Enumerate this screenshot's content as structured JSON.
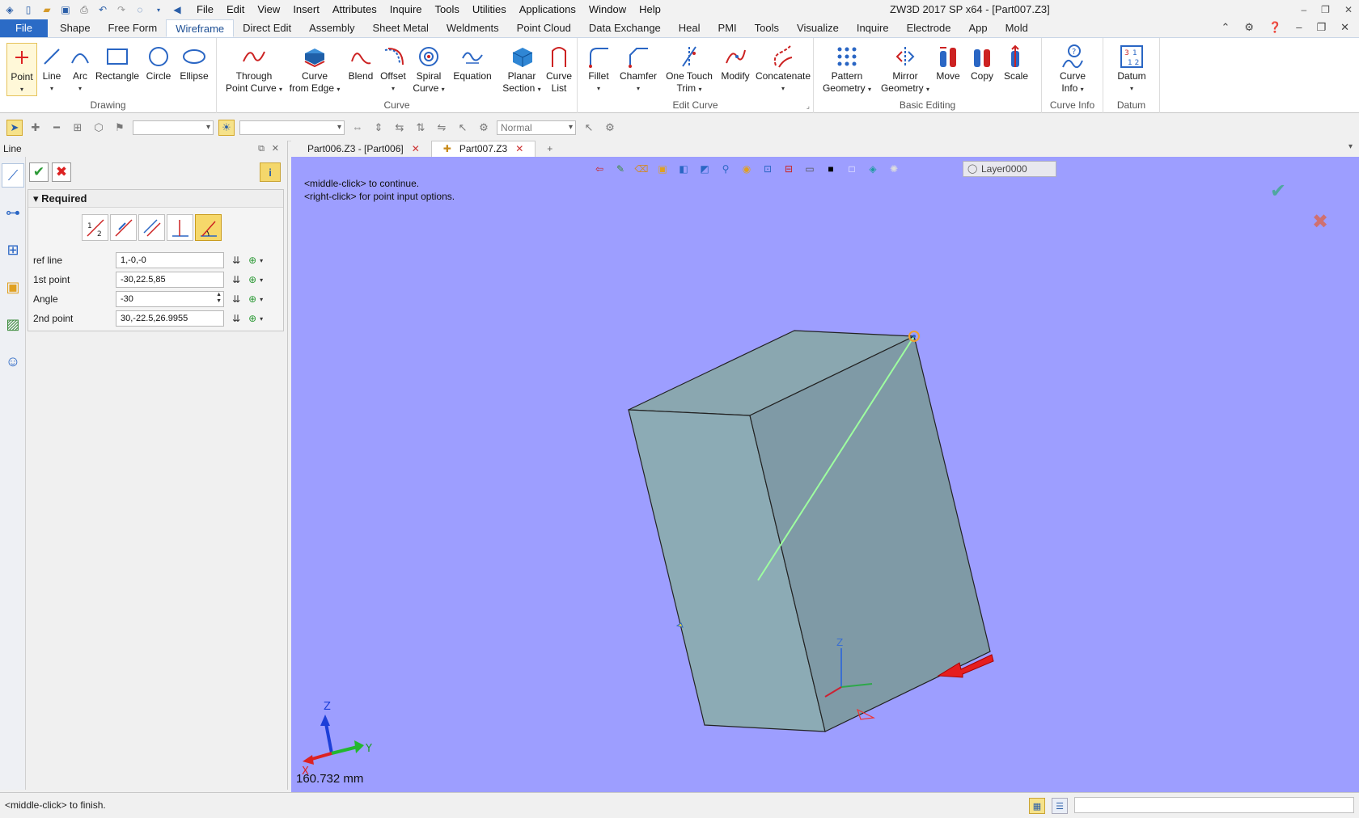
{
  "app": {
    "title": "ZW3D 2017 SP x64 - [Part007.Z3]",
    "menus": [
      "File",
      "Edit",
      "View",
      "Insert",
      "Attributes",
      "Inquire",
      "Tools",
      "Utilities",
      "Applications",
      "Window",
      "Help"
    ]
  },
  "ribbon_tabs": [
    "File",
    "Shape",
    "Free Form",
    "Wireframe",
    "Direct Edit",
    "Assembly",
    "Sheet Metal",
    "Weldments",
    "Point Cloud",
    "Data Exchange",
    "Heal",
    "PMI",
    "Tools",
    "Visualize",
    "Inquire",
    "Electrode",
    "App",
    "Mold"
  ],
  "ribbon": {
    "drawing": {
      "label": "Drawing",
      "point": "Point",
      "line": "Line",
      "arc": "Arc",
      "rectangle": "Rectangle",
      "circle": "Circle",
      "ellipse": "Ellipse"
    },
    "curve": {
      "label": "Curve",
      "through1": "Through",
      "through2": "Point Curve",
      "edge1": "Curve",
      "edge2": "from Edge",
      "blend": "Blend",
      "offset": "Offset",
      "spiral1": "Spiral",
      "spiral2": "Curve",
      "equation": "Equation",
      "planar1": "Planar",
      "planar2": "Section",
      "list1": "Curve",
      "list2": "List"
    },
    "edit_curve": {
      "label": "Edit Curve",
      "fillet": "Fillet",
      "chamfer": "Chamfer",
      "trim1": "One Touch",
      "trim2": "Trim",
      "modify": "Modify",
      "concatenate": "Concatenate"
    },
    "basic_editing": {
      "label": "Basic Editing",
      "pattern1": "Pattern",
      "pattern2": "Geometry",
      "mirror1": "Mirror",
      "mirror2": "Geometry",
      "move": "Move",
      "copy": "Copy",
      "scale": "Scale"
    },
    "curve_info": {
      "label": "Curve Info",
      "btn1": "Curve",
      "btn2": "Info"
    },
    "datum": {
      "label": "Datum",
      "btn": "Datum"
    }
  },
  "toolbar2": {
    "render_mode": "Normal"
  },
  "panel": {
    "title": "Line",
    "section": "Required",
    "fields": [
      {
        "label": "ref line",
        "value": "1,-0,-0"
      },
      {
        "label": "1st point",
        "value": "-30,22.5,85"
      },
      {
        "label": "Angle",
        "value": "-30"
      },
      {
        "label": "2nd point",
        "value": "30,-22.5,26.9955"
      }
    ]
  },
  "doc_tabs": [
    "Part006.Z3 - [Part006]",
    "Part007.Z3"
  ],
  "viewport": {
    "hint1": "<middle-click> to continue.",
    "hint2": "<right-click> for point input options.",
    "layer": "Layer0000",
    "measure": "160.732 mm",
    "axis_x": "X",
    "axis_y": "Y",
    "axis_z": "Z",
    "axis_z_small": "Z"
  },
  "status": {
    "text": "<middle-click> to finish."
  },
  "colors": {
    "viewport_bg": "#9d9eff",
    "accent": "#2b6bc6",
    "highlight": "#f6d86a"
  }
}
